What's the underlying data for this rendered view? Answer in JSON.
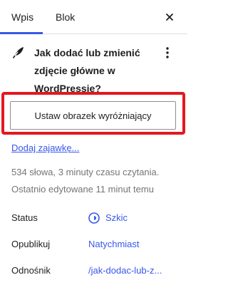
{
  "tabs": {
    "post": "Wpis",
    "block": "Blok"
  },
  "post": {
    "title": "Jak dodać lub zmienić zdjęcie główne w WordPressie?"
  },
  "featured_image": {
    "button_label": "Ustaw obrazek wyróżniający"
  },
  "excerpt": {
    "link_label": "Dodaj zajawkę..."
  },
  "meta": {
    "words_reading": "534 słowa, 3 minuty czasu czytania.",
    "last_edited": "Ostatnio edytowane 11 minut temu"
  },
  "summary": {
    "status": {
      "label": "Status",
      "value": "Szkic"
    },
    "publish": {
      "label": "Opublikuj",
      "value": "Natychmiast"
    },
    "link": {
      "label": "Odnośnik",
      "value": "/jak-dodac-lub-z..."
    }
  },
  "colors": {
    "accent": "#3858e9",
    "highlight": "#e4171f",
    "muted": "#757575"
  },
  "icons": {
    "close": "close-icon",
    "post": "quill-pen-icon",
    "more": "more-vertical-icon",
    "status": "draft-status-icon"
  }
}
